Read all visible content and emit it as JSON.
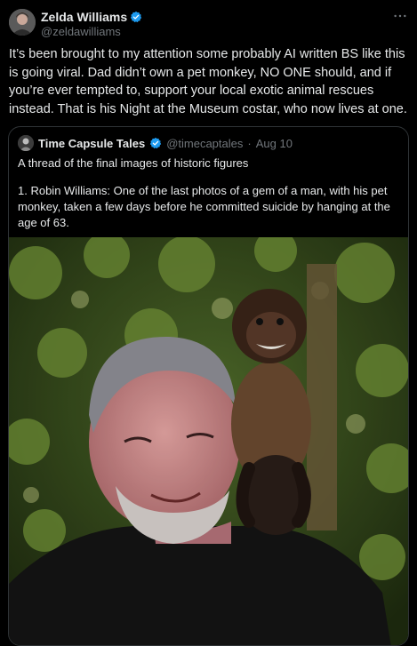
{
  "post": {
    "author": {
      "display_name": "Zelda Williams",
      "handle": "@zeldawilliams",
      "verified": true,
      "avatar_icon": "user-avatar"
    },
    "more_icon": "more-dots",
    "text": "It’s been brought to my attention some probably AI written BS like this is going viral. Dad didn’t own a pet monkey, NO ONE should, and if you’re ever tempted to, support your local exotic animal rescues instead. That is his Night at the Museum costar, who now lives at one."
  },
  "quote": {
    "author": {
      "display_name": "Time Capsule Tales",
      "handle": "@timecaptales",
      "verified": true,
      "avatar_icon": "user-avatar"
    },
    "separator": "·",
    "date": "Aug 10",
    "text_lines": [
      "A thread of the final images of historic figures",
      "1. Robin Williams: One of the last photos of a gem of a man, with his pet monkey, taken a few days before he committed suicide by hanging at the age of 63."
    ],
    "image": {
      "icon": "photo"
    }
  },
  "colors": {
    "background": "#000000",
    "text_primary": "#e7e9ea",
    "text_secondary": "#71767b",
    "verified_blue": "#1d9bf0",
    "border": "#2f3336"
  }
}
